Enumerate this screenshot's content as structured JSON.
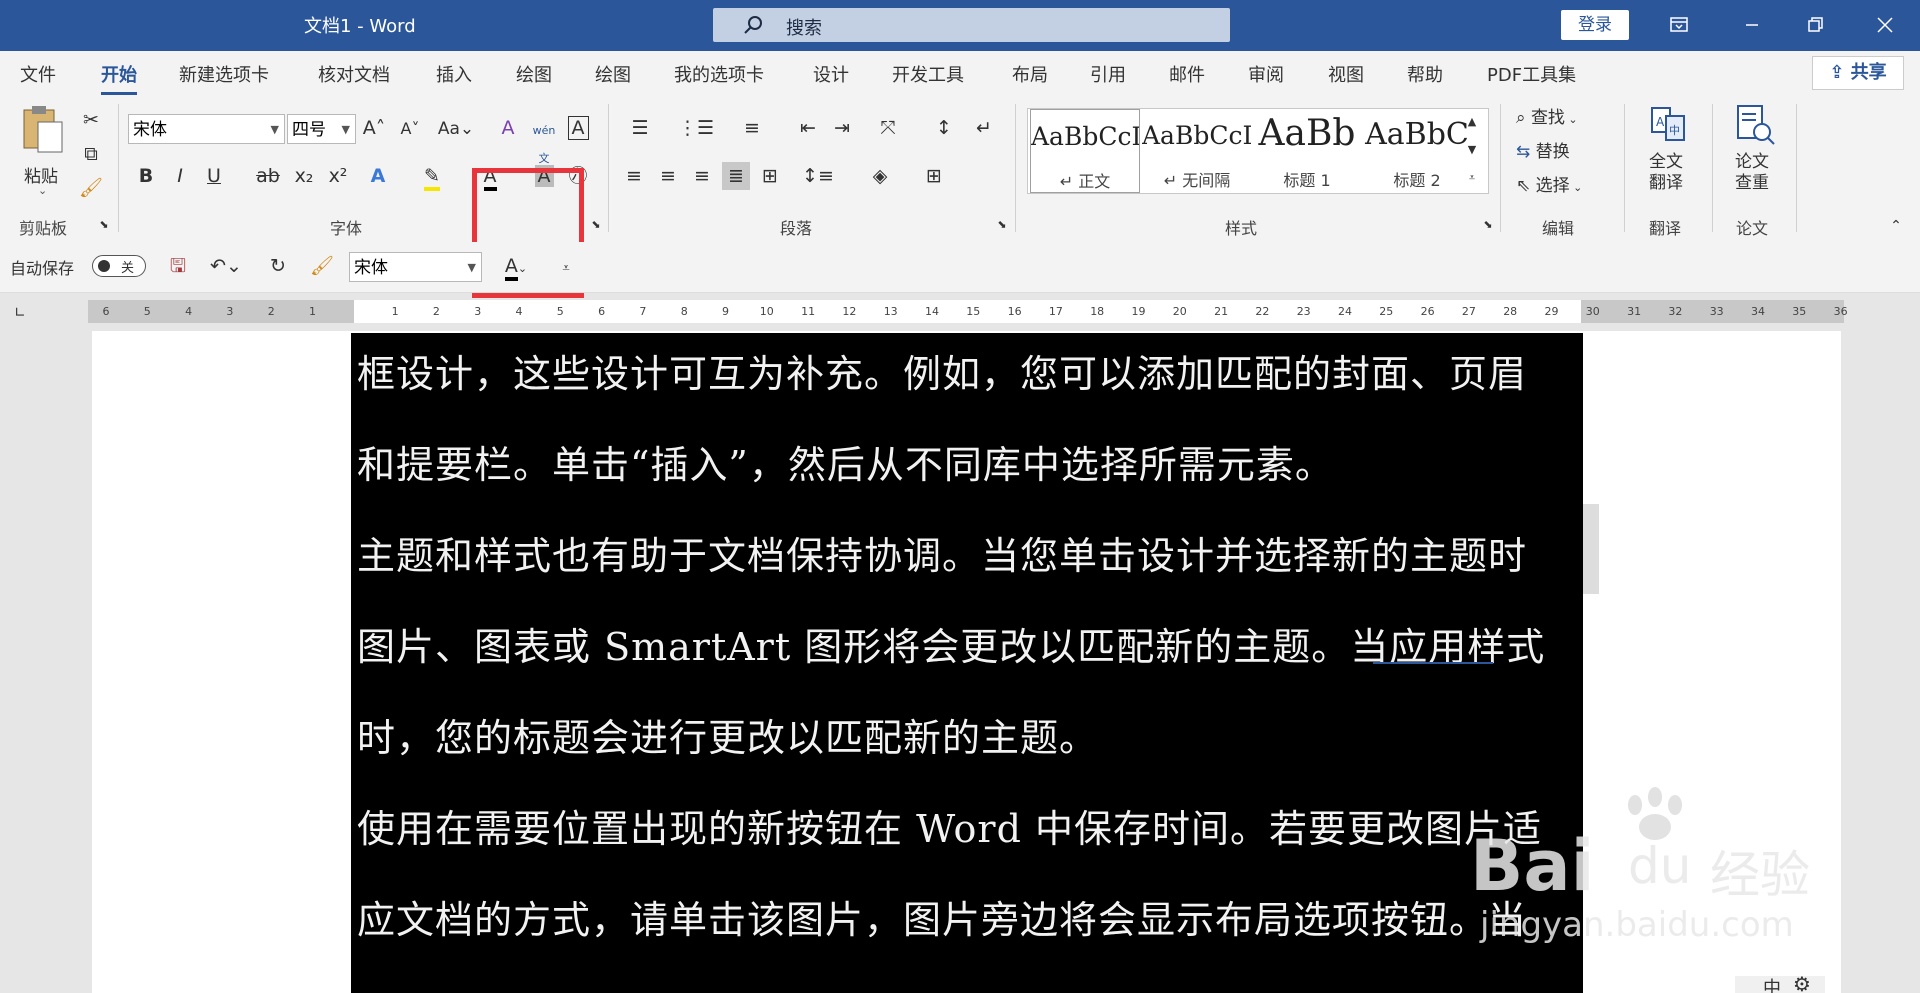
{
  "titlebar": {
    "title": "文档1  -  Word",
    "search_label": "搜索",
    "login_label": "登录"
  },
  "tabs": [
    {
      "label": "文件"
    },
    {
      "label": "开始"
    },
    {
      "label": "新建选项卡"
    },
    {
      "label": "核对文档"
    },
    {
      "label": "插入"
    },
    {
      "label": "绘图"
    },
    {
      "label": "绘图"
    },
    {
      "label": "我的选项卡"
    },
    {
      "label": "设计"
    },
    {
      "label": "开发工具"
    },
    {
      "label": "布局"
    },
    {
      "label": "引用"
    },
    {
      "label": "邮件"
    },
    {
      "label": "审阅"
    },
    {
      "label": "视图"
    },
    {
      "label": "帮助"
    },
    {
      "label": "PDF工具集"
    }
  ],
  "share_label": "共享",
  "ribbon": {
    "clipboard": {
      "paste_label": "粘贴",
      "group_label": "剪贴板"
    },
    "font": {
      "font_name": "宋体",
      "font_size": "四号",
      "group_label": "字体"
    },
    "paragraph": {
      "group_label": "段落"
    },
    "styles": {
      "group_label": "样式",
      "items": [
        {
          "sample": "AaBbCcI",
          "name": "↵ 正文"
        },
        {
          "sample": "AaBbCcI",
          "name": "↵ 无间隔"
        },
        {
          "sample": "AaBb",
          "name": "标题 1"
        },
        {
          "sample": "AaBbC",
          "name": "标题 2"
        }
      ]
    },
    "editing": {
      "find_label": "查找",
      "replace_label": "替换",
      "select_label": "选择",
      "group_label": "编辑"
    },
    "translate": {
      "button_label": "全文\n翻译",
      "group_label": "翻译"
    },
    "paper": {
      "button_label": "论文\n查重",
      "group_label": "论文"
    }
  },
  "qat": {
    "autosave_label": "自动保存",
    "toggle_label": "关",
    "font_name": "宋体"
  },
  "ruler": {
    "ticks": [
      "6",
      "5",
      "4",
      "3",
      "2",
      "1",
      "",
      "1",
      "2",
      "3",
      "4",
      "5",
      "6",
      "7",
      "8",
      "9",
      "10",
      "11",
      "12",
      "13",
      "14",
      "15",
      "16",
      "17",
      "18",
      "19",
      "20",
      "21",
      "22",
      "23",
      "24",
      "25",
      "26",
      "27",
      "28",
      "29",
      "30",
      "31",
      "32",
      "33",
      "34",
      "35",
      "36"
    ]
  },
  "document": {
    "lines": [
      "框设计，这些设计可互为补充。例如，您可以添加匹配的封面、页眉",
      "和提要栏。单击“插入”，然后从不同库中选择所需元素。",
      "主题和样式也有助于文档保持协调。当您单击设计并选择新的主题时",
      "图片、图表或 SmartArt 图形将会更改以匹配新的主题。当应用样式",
      "时，您的标题会进行更改以匹配新的主题。",
      "使用在需要位置出现的新按钮在 Word 中保存时间。若要更改图片适",
      "应文档的方式，请单击该图片，图片旁边将会显示布局选项按钮。当"
    ]
  },
  "watermark": {
    "brand": "Bai",
    "brand2": "du",
    "cn": "经验",
    "url": "jingyan.baidu.com"
  },
  "status": {
    "lang": "中"
  }
}
